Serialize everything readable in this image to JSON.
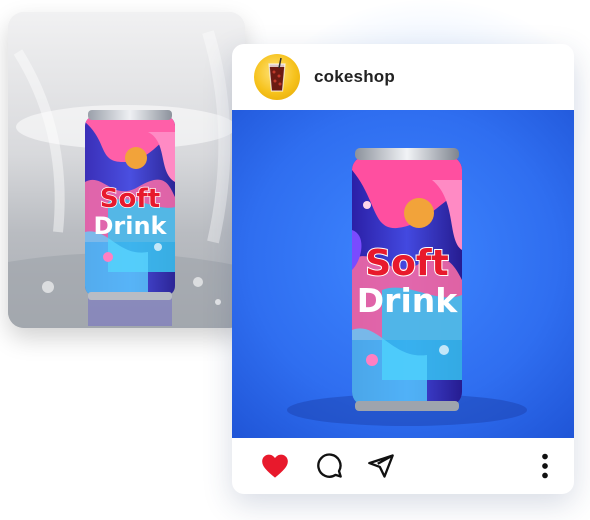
{
  "post": {
    "username": "cokeshop",
    "avatar_icon": "soda-glass-icon",
    "image_can_text": {
      "line1": "Soft",
      "line2": "Drink"
    }
  },
  "back_photo": {
    "can_text": {
      "line1": "Soft",
      "line2": "Drink"
    }
  },
  "actions": {
    "like_icon": "heart-icon",
    "comment_icon": "comment-icon",
    "share_icon": "send-icon",
    "more_icon": "more-vertical-icon",
    "liked": true
  },
  "colors": {
    "like_red": "#e8192c",
    "post_background_blue": "#2f6ef0",
    "can_text_red": "#e8192c",
    "avatar_yellow": "#f6c21c"
  }
}
